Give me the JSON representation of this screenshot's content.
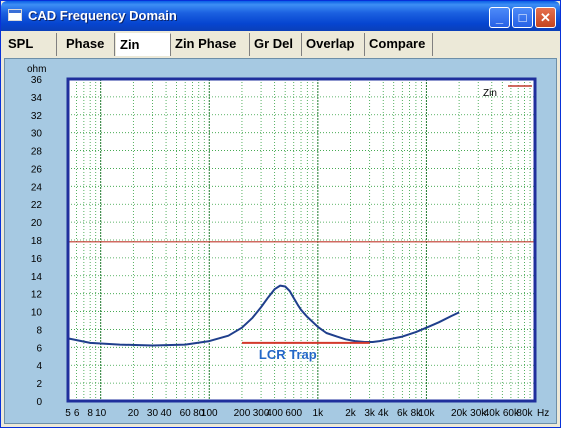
{
  "window": {
    "title": "CAD Frequency Domain",
    "buttons": {
      "minimize": "_",
      "maximize": "□",
      "close": "✕"
    }
  },
  "tabs": [
    {
      "label": "SPL",
      "active": false
    },
    {
      "label": "Phase",
      "active": false
    },
    {
      "label": "Zin",
      "active": true
    },
    {
      "label": "Zin Phase",
      "active": false
    },
    {
      "label": "Gr Del",
      "active": false
    },
    {
      "label": "Overlap",
      "active": false
    },
    {
      "label": "Compare",
      "active": false
    }
  ],
  "chart_data": {
    "type": "line",
    "ylabel": "ohm",
    "y_scale": "linear",
    "ylim": [
      0,
      36
    ],
    "y_ticks": [
      0,
      2,
      4,
      6,
      8,
      10,
      12,
      14,
      16,
      18,
      20,
      22,
      24,
      26,
      28,
      30,
      32,
      34,
      36
    ],
    "x_scale": "log",
    "x_unit": "Hz",
    "xlim": [
      5,
      100000
    ],
    "x_tick_labels": [
      {
        "v": 5,
        "t": "5"
      },
      {
        "v": 6,
        "t": "6"
      },
      {
        "v": 8,
        "t": "8"
      },
      {
        "v": 10,
        "t": "10"
      },
      {
        "v": 20,
        "t": "20"
      },
      {
        "v": 30,
        "t": "30"
      },
      {
        "v": 40,
        "t": "40"
      },
      {
        "v": 60,
        "t": "60"
      },
      {
        "v": 80,
        "t": "80"
      },
      {
        "v": 100,
        "t": "100"
      },
      {
        "v": 200,
        "t": "200"
      },
      {
        "v": 300,
        "t": "300"
      },
      {
        "v": 400,
        "t": "400"
      },
      {
        "v": 600,
        "t": "600"
      },
      {
        "v": 1000,
        "t": "1k"
      },
      {
        "v": 2000,
        "t": "2k"
      },
      {
        "v": 3000,
        "t": "3k"
      },
      {
        "v": 4000,
        "t": "4k"
      },
      {
        "v": 6000,
        "t": "6k"
      },
      {
        "v": 8000,
        "t": "8k"
      },
      {
        "v": 10000,
        "t": "10k"
      },
      {
        "v": 20000,
        "t": "20k"
      },
      {
        "v": 30000,
        "t": "30k"
      },
      {
        "v": 40000,
        "t": "40k"
      },
      {
        "v": 60000,
        "t": "60k"
      },
      {
        "v": 80000,
        "t": "80k"
      }
    ],
    "grid": true,
    "legend": {
      "label": "Zin",
      "position": "top-right",
      "color": "#c0392b"
    },
    "series": [
      {
        "name": "Zin",
        "color": "#1f3f8c",
        "x": [
          5,
          8,
          15,
          30,
          60,
          100,
          150,
          200,
          250,
          300,
          350,
          400,
          450,
          500,
          550,
          600,
          650,
          700,
          800,
          1000,
          1200,
          1500,
          1800,
          2200,
          2700,
          3200,
          3700,
          4500,
          6000,
          8000,
          10000,
          13000,
          17000,
          20000
        ],
        "y": [
          7.0,
          6.5,
          6.3,
          6.2,
          6.3,
          6.7,
          7.3,
          8.2,
          9.3,
          10.5,
          11.6,
          12.5,
          12.9,
          12.8,
          12.3,
          11.5,
          10.8,
          10.2,
          9.4,
          8.3,
          7.6,
          7.2,
          6.9,
          6.7,
          6.6,
          6.6,
          6.7,
          6.9,
          7.2,
          7.7,
          8.2,
          8.8,
          9.5,
          9.9
        ]
      }
    ],
    "reference_lines": [
      {
        "y": 17.8,
        "color": "#c0392b"
      }
    ],
    "annotations": [
      {
        "text": "LCR Trap",
        "x_start": 200,
        "x_end": 3000,
        "y": 6.5,
        "color": "#d33a2c"
      }
    ],
    "colors": {
      "background": "#ffffff",
      "major_grid": "#1f7a2e",
      "minor_grid": "#2e9e3c",
      "frame": "#1f2f9c",
      "panel": "#a6c9e2"
    }
  }
}
